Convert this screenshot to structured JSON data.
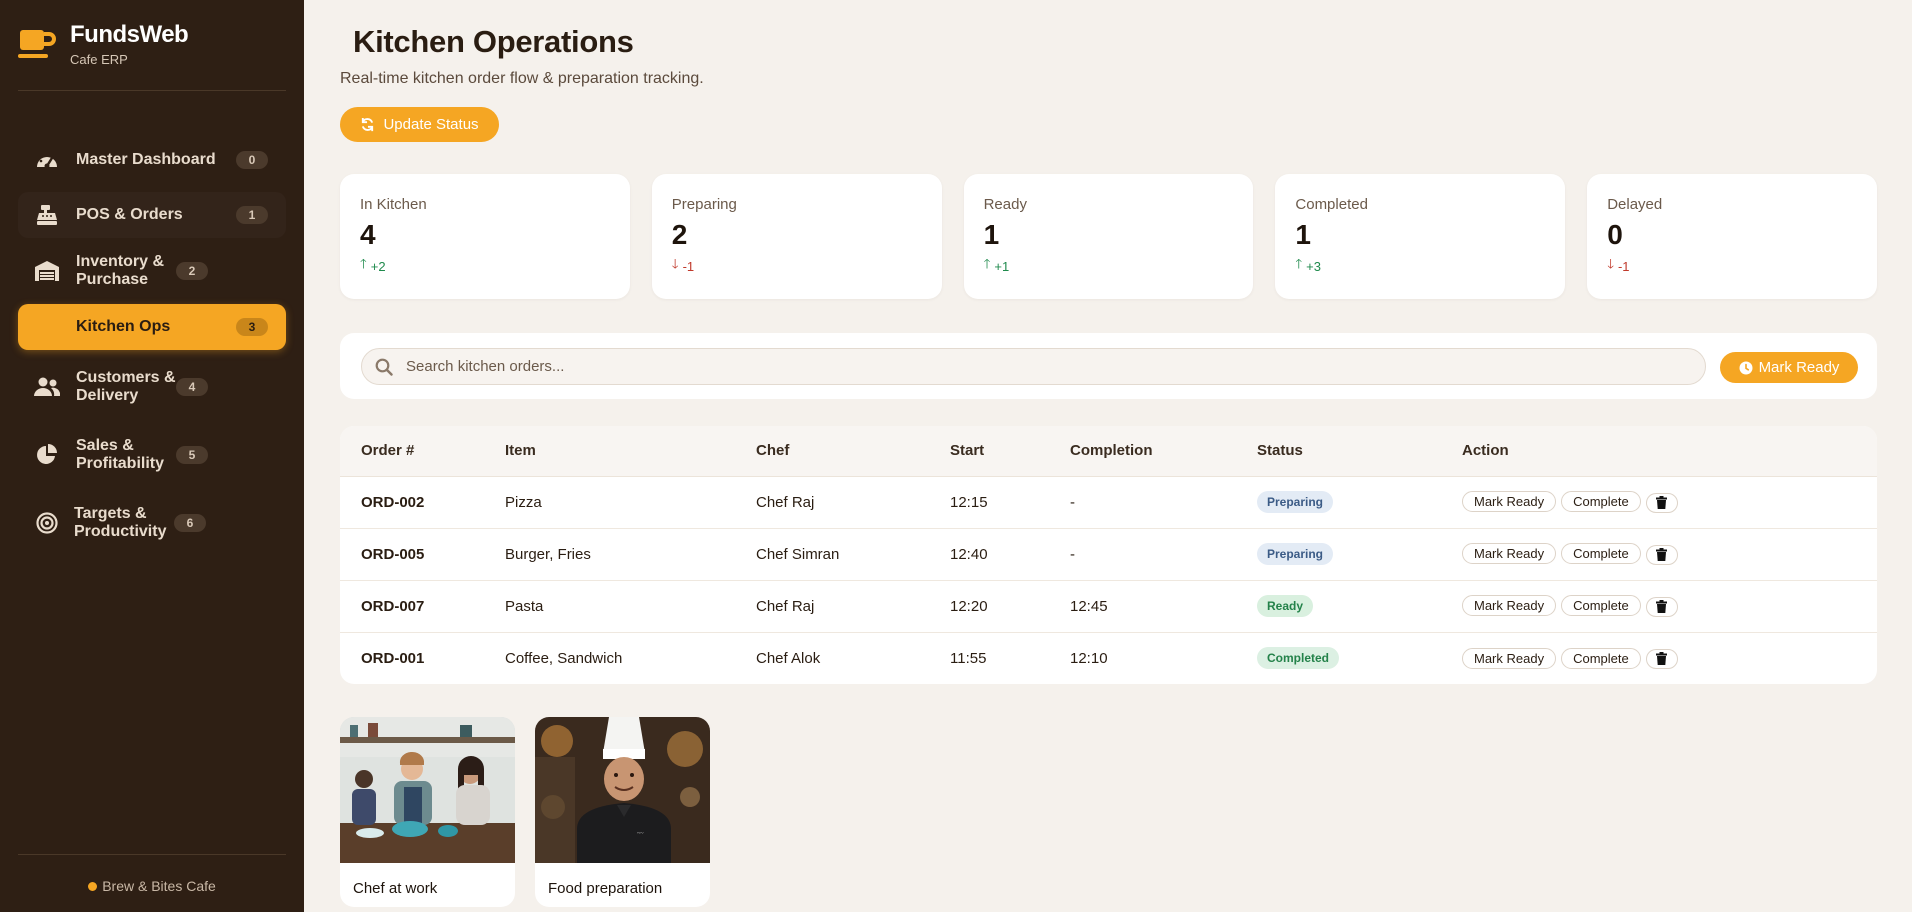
{
  "brand": {
    "title": "FundsWeb",
    "subtitle": "Cafe ERP",
    "icon": "coffee-cup-icon"
  },
  "sidebar": {
    "items": [
      {
        "label": "Master Dashboard",
        "badge": "0",
        "icon": "gauge-icon"
      },
      {
        "label": "POS & Orders",
        "badge": "1",
        "icon": "cash-register-icon"
      },
      {
        "label": "Inventory & Purchase",
        "badge": "2",
        "icon": "warehouse-icon"
      },
      {
        "label": "Kitchen Ops",
        "badge": "3",
        "icon": "fire-icon",
        "active": true
      },
      {
        "label": "Customers & Delivery",
        "badge": "4",
        "icon": "users-icon"
      },
      {
        "label": "Sales & Profitability",
        "badge": "5",
        "icon": "pie-chart-icon"
      },
      {
        "label": "Targets & Productivity",
        "badge": "6",
        "icon": "target-icon"
      }
    ],
    "footer": "Brew & Bites Cafe"
  },
  "header": {
    "title": "Kitchen Operations",
    "subtitle": "Real-time kitchen order flow & preparation tracking.",
    "update_button": "Update Status"
  },
  "stats": [
    {
      "label": "In Kitchen",
      "value": "4",
      "delta": "+2",
      "trend": "up"
    },
    {
      "label": "Preparing",
      "value": "2",
      "delta": "-1",
      "trend": "down"
    },
    {
      "label": "Ready",
      "value": "1",
      "delta": "+1",
      "trend": "up"
    },
    {
      "label": "Completed",
      "value": "1",
      "delta": "+3",
      "trend": "up"
    },
    {
      "label": "Delayed",
      "value": "0",
      "delta": "-1",
      "trend": "down"
    }
  ],
  "search": {
    "placeholder": "Search kitchen orders...",
    "value": "",
    "mark_ready_label": "Mark Ready"
  },
  "table": {
    "columns": [
      "Order #",
      "Item",
      "Chef",
      "Start",
      "Completion",
      "Status",
      "Action"
    ],
    "rows": [
      {
        "order": "ORD-002",
        "item": "Pizza",
        "chef": "Chef Raj",
        "start": "12:15",
        "completion": "-",
        "status": "Preparing"
      },
      {
        "order": "ORD-005",
        "item": "Burger, Fries",
        "chef": "Chef Simran",
        "start": "12:40",
        "completion": "-",
        "status": "Preparing"
      },
      {
        "order": "ORD-007",
        "item": "Pasta",
        "chef": "Chef Raj",
        "start": "12:20",
        "completion": "12:45",
        "status": "Ready"
      },
      {
        "order": "ORD-001",
        "item": "Coffee, Sandwich",
        "chef": "Chef Alok",
        "start": "11:55",
        "completion": "12:10",
        "status": "Completed"
      }
    ],
    "actions": {
      "mark_ready": "Mark Ready",
      "complete": "Complete",
      "delete_icon": "trash-icon"
    }
  },
  "gallery": [
    {
      "caption": "Chef at work"
    },
    {
      "caption": "Food preparation"
    }
  ],
  "colors": {
    "accent": "#f5a623",
    "sidebar": "#2e1f14",
    "background": "#f5f1ec"
  }
}
